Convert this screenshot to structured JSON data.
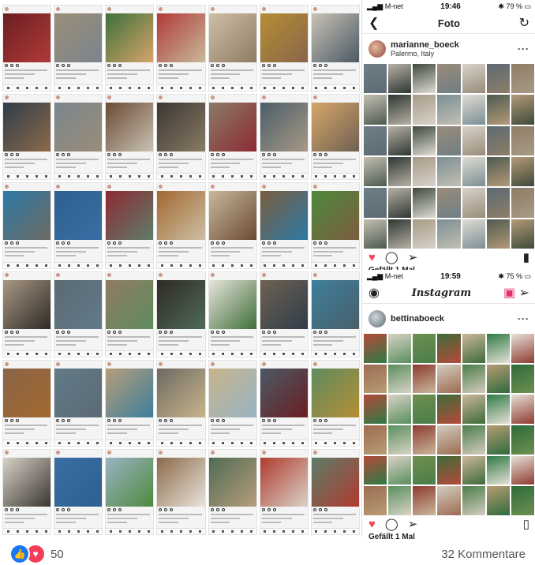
{
  "collage": {
    "phone_top": {
      "carrier": "M-net",
      "time": "19:46",
      "battery": "79 %",
      "title": "Foto",
      "username": "marianne_boeck",
      "location": "Palermo, Italy",
      "more": "···",
      "likes_text": "Gefällt 1 Mal",
      "colors": [
        "#6f7f86",
        "#b7b0a4",
        "#3e4a3b",
        "#9a8b78",
        "#d7d3ca",
        "#5c6a74",
        "#8e7d66",
        "#c3bfb2",
        "#2e3833",
        "#a89a86",
        "#7b8f95",
        "#e0dcd4",
        "#4d5a4f",
        "#b49a78"
      ]
    },
    "phone_bottom": {
      "carrier": "M-net",
      "time": "19:59",
      "battery": "75 %",
      "title": "Instagram",
      "username": "bettinaboeck",
      "more": "···",
      "likes_text": "Gefällt 1 Mal",
      "colors": [
        "#b44a3a",
        "#d8d2c6",
        "#6e8f4f",
        "#3f6b3a",
        "#c9b79a",
        "#2f7a45",
        "#e6e1d8",
        "#9c6c52",
        "#5a8f5e",
        "#8e3b31",
        "#d3ccbf",
        "#4b7d4a",
        "#b89c74",
        "#2e6b3c"
      ]
    },
    "grid_colors": [
      "#6a1e22",
      "#9b8d77",
      "#3e6f3a",
      "#b13a38",
      "#cdbfa6",
      "#b58e35",
      "#c9c2b4",
      "#2f3d4a",
      "#7a858e",
      "#6b4a33",
      "#3b3531",
      "#8a7b66",
      "#4a5f6a",
      "#d6a56a",
      "#2c7aa6",
      "#2d5f8f",
      "#8e2a34",
      "#a2682f",
      "#c8b99a",
      "#7b5c3e",
      "#4e8a3d",
      "#a89884",
      "#5a6a74",
      "#8f7b63",
      "#2f2a26",
      "#e8e4dc",
      "#6f6152",
      "#3d7f9c",
      "#8a6548",
      "#627a88",
      "#b69d7a",
      "#6e6a62",
      "#c7b48b",
      "#4a5a66",
      "#5f8c60",
      "#d8d2c8",
      "#3a6fa5",
      "#9ab3c4",
      "#8c6a4a",
      "#4f6b55",
      "#b03a2e",
      "#5d7d6a"
    ],
    "labels": {
      "foto": "Foto"
    }
  },
  "footer": {
    "like_icon": "thumbs-up-icon",
    "love_icon": "heart-icon",
    "reactions_count": "50",
    "comments": "32 Kommentare"
  }
}
